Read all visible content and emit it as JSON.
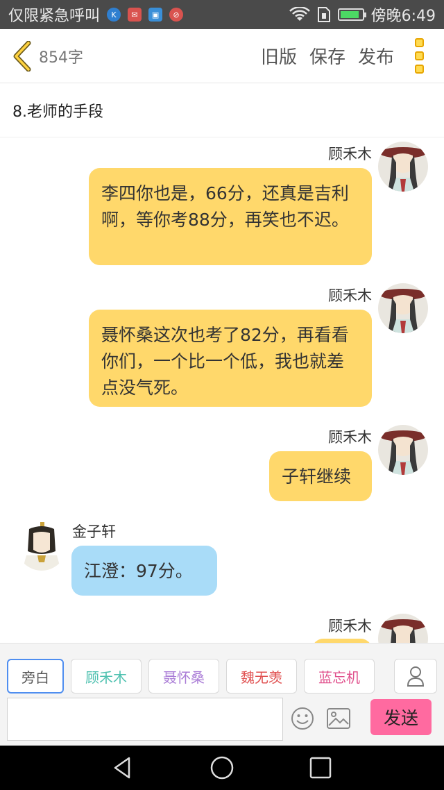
{
  "status_bar": {
    "carrier": "仅限紧急呼叫",
    "notification_icons": [
      "k-icon",
      "mail-icon",
      "image-icon",
      "blocked-icon"
    ],
    "time": "傍晚6:49"
  },
  "toolbar": {
    "word_count": "854字",
    "old_version_label": "旧版",
    "save_label": "保存",
    "publish_label": "发布",
    "accent_color": "#ffd23f"
  },
  "chapter": {
    "title": "8.老师的手段"
  },
  "messages": [
    {
      "side": "right",
      "speaker": "顾禾木",
      "text": "李四你也是，66分，还真是吉利啊，等你考88分，再笑也不迟。"
    },
    {
      "side": "right",
      "speaker": "顾禾木",
      "text": "聂怀桑这次也考了82分，再看看你们，一个比一个低，我也就差点没气死。"
    },
    {
      "side": "right",
      "speaker": "顾禾木",
      "text": "子轩继续"
    },
    {
      "side": "left",
      "speaker": "金子轩",
      "text": "江澄：97分。"
    },
    {
      "side": "right",
      "speaker": "顾禾木",
      "text": ""
    }
  ],
  "characters": [
    {
      "label": "旁白",
      "color": "#555555"
    },
    {
      "label": "顾禾木",
      "color": "#4fc1b0"
    },
    {
      "label": "聂怀桑",
      "color": "#a97bd6"
    },
    {
      "label": "魏无羡",
      "color": "#e05050"
    },
    {
      "label": "蓝忘机",
      "color": "#e0508c"
    }
  ],
  "composer": {
    "input_value": "",
    "send_label": "发送",
    "send_color": "#ff6aa0"
  },
  "colors": {
    "right_bubble": "#ffd86b",
    "left_bubble": "#a9dcf8"
  }
}
